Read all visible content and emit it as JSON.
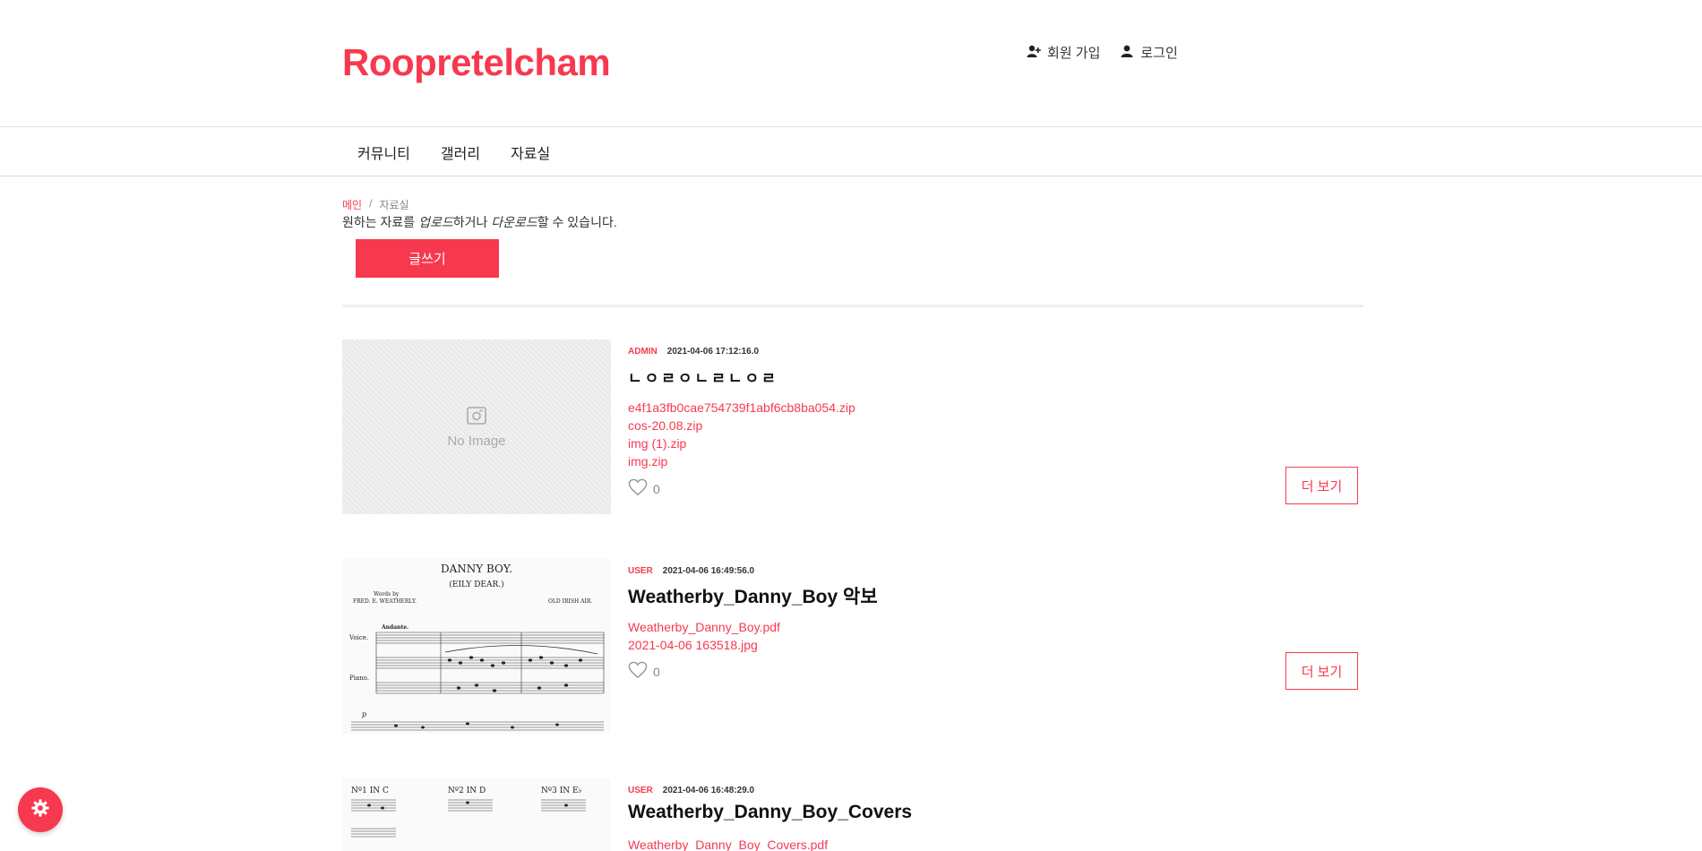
{
  "header": {
    "logo": "Roopretelcham",
    "signup_label": "회원 가입",
    "login_label": "로그인"
  },
  "nav": {
    "items": [
      {
        "label": "커뮤니티"
      },
      {
        "label": "갤러리"
      },
      {
        "label": "자료실"
      }
    ]
  },
  "breadcrumb": {
    "home": "메인",
    "separator": "/",
    "current": "자료실"
  },
  "description": {
    "part1": "원하는 자료를 ",
    "upload": "업로드",
    "part2": "하거나 ",
    "download": "다운로드",
    "part3": "할 수 있습니다."
  },
  "write_button_label": "글쓰기",
  "posts": [
    {
      "author": "ADMIN",
      "date": "2021-04-06 17:12:16.0",
      "title": "ㄴㅇㄹㅇㄴㄹㄴㅇㄹ",
      "thumbnail_text": "No Image",
      "files": [
        "e4f1a3fb0cae754739f1abf6cb8ba054.zip",
        "cos-20.08.zip",
        "img (1).zip",
        "img.zip"
      ],
      "likes": "0",
      "more_label": "더 보기"
    },
    {
      "author": "USER",
      "date": "2021-04-06 16:49:56.0",
      "title": "Weatherby_Danny_Boy 악보",
      "thumbnail": {
        "heading": "DANNY BOY.",
        "subheading": "(EILY DEAR.)",
        "words_by": "Words by",
        "author": "FRED. E. WEATHERLY.",
        "air": "OLD IRISH AIR.",
        "tempo": "Andante.",
        "voice": "Voice.",
        "piano": "Piano.",
        "dynamic": "p"
      },
      "files": [
        "Weatherby_Danny_Boy.pdf",
        "2021-04-06 163518.jpg"
      ],
      "likes": "0",
      "more_label": "더 보기"
    },
    {
      "author": "USER",
      "date": "2021-04-06 16:48:29.0",
      "title": "Weatherby_Danny_Boy_Covers",
      "thumbnail": {
        "key1": "Nº1 IN C",
        "key2": "Nº2 IN D",
        "key3": "Nº3 IN E♭"
      },
      "files": [
        "Weatherby_Danny_Boy_Covers.pdf"
      ]
    }
  ],
  "colors": {
    "accent": "#f7394f",
    "divider": "#eeeeee"
  },
  "icons": {
    "signup": "user-plus-icon",
    "login": "user-icon",
    "like": "heart-icon",
    "settings": "gear-icon"
  }
}
